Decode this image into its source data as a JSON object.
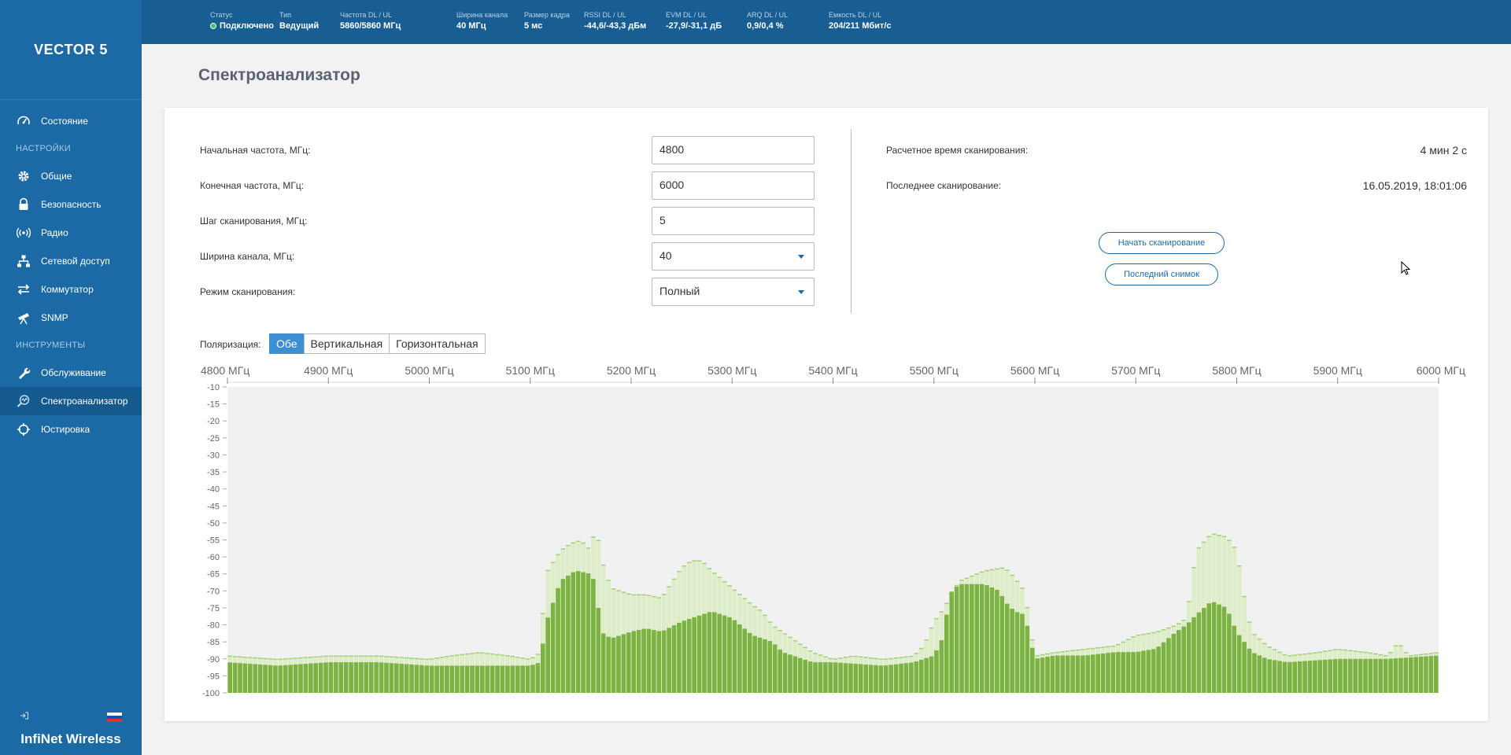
{
  "sidebar": {
    "brand": "VECTOR 5",
    "items": [
      {
        "label": "Состояние",
        "icon": "gauge-icon"
      },
      {
        "section": "НАСТРОЙКИ"
      },
      {
        "label": "Общие",
        "icon": "gear-icon"
      },
      {
        "label": "Безопасность",
        "icon": "lock-icon"
      },
      {
        "label": "Радио",
        "icon": "radio-waves-icon"
      },
      {
        "label": "Сетевой доступ",
        "icon": "network-icon"
      },
      {
        "label": "Коммутатор",
        "icon": "switch-arrows-icon"
      },
      {
        "label": "SNMP",
        "icon": "telescope-icon"
      },
      {
        "section": "ИНСТРУМЕНТЫ"
      },
      {
        "label": "Обслуживание",
        "icon": "wrench-icon"
      },
      {
        "label": "Спектроанализатор",
        "icon": "spectrum-search-icon",
        "active": true
      },
      {
        "label": "Юстировка",
        "icon": "crosshair-icon"
      }
    ],
    "company": "InfiNet Wireless"
  },
  "topbar": {
    "stats": [
      {
        "label": "Статус",
        "value": "Подключено"
      },
      {
        "label": "Тип",
        "value": "Ведущий"
      },
      {
        "label": "Частота DL / UL",
        "value": "5860/5860 МГц"
      },
      {
        "label": "Ширина канала",
        "value": "40 МГц"
      },
      {
        "label": "Размер кадра",
        "value": "5 мс"
      },
      {
        "label": "RSSI DL / UL",
        "value": "-44,6/-43,3 дБм"
      },
      {
        "label": "EVM DL / UL",
        "value": "-27,9/-31,1 дБ"
      },
      {
        "label": "ARQ DL / UL",
        "value": "0,9/0,4 %"
      },
      {
        "label": "Емкость DL / UL",
        "value": "204/211 Мбит/с"
      }
    ]
  },
  "page": {
    "title": "Спектроанализатор"
  },
  "form": {
    "start_label": "Начальная частота, МГц:",
    "start_value": "4800",
    "end_label": "Конечная частота, МГц:",
    "end_value": "6000",
    "step_label": "Шаг сканирования, МГц:",
    "step_value": "5",
    "width_label": "Ширина канала, МГц:",
    "width_value": "40",
    "mode_label": "Режим сканирования:",
    "mode_value": "Полный"
  },
  "info": {
    "est_label": "Расчетное время сканирования:",
    "est_value": "4 мин 2 с",
    "last_label": "Последнее сканирование:",
    "last_value": "16.05.2019, 18:01:06",
    "start_scan_button": "Начать сканирование",
    "last_snapshot_button": "Последний снимок"
  },
  "polarization": {
    "label": "Поляризация:",
    "options": [
      "Обе",
      "Вертикальная",
      "Горизонтальная"
    ],
    "selected": "Обе"
  },
  "colors": {
    "sidebar": "#1b6aa5",
    "topbar": "#185e93",
    "accent": "#3d8fd4",
    "bar_current": "#7cb342",
    "bar_peak": "#dcedc8"
  },
  "chart_data": {
    "type": "bar",
    "x_ticks": [
      "4800 МГц",
      "4900 МГц",
      "5000 МГц",
      "5100 МГц",
      "5200 МГц",
      "5300 МГц",
      "5400 МГц",
      "5500 МГц",
      "5600 МГц",
      "5700 МГц",
      "5800 МГц",
      "5900 МГц",
      "6000 МГц"
    ],
    "y_ticks": [
      -10,
      -15,
      -20,
      -25,
      -30,
      -35,
      -40,
      -45,
      -50,
      -55,
      -60,
      -65,
      -70,
      -75,
      -80,
      -85,
      -90,
      -95,
      -100
    ],
    "xlim": [
      4800,
      6000
    ],
    "ylim": [
      -100,
      -10
    ],
    "grid": false,
    "series": [
      {
        "x": [
          4800,
          4850,
          4900,
          4950,
          5000,
          5050,
          5100,
          5110,
          5115,
          5130,
          5145,
          5160,
          5165,
          5170,
          5180,
          5200,
          5215,
          5230,
          5250,
          5260,
          5280,
          5300,
          5320,
          5340,
          5350,
          5360,
          5380,
          5400,
          5450,
          5480,
          5490,
          5500,
          5510,
          5515,
          5525,
          5550,
          5565,
          5570,
          5580,
          5590,
          5600,
          5620,
          5650,
          5680,
          5700,
          5720,
          5740,
          5750,
          5760,
          5775,
          5790,
          5800,
          5810,
          5815,
          5830,
          5850,
          5900,
          5950,
          6000
        ],
        "values": [
          -91,
          -92,
          -91,
          -91,
          -92,
          -92,
          -92,
          -91,
          -80,
          -67,
          -64,
          -65,
          -68,
          -82,
          -84,
          -82,
          -81,
          -82,
          -79,
          -78,
          -76,
          -78,
          -83,
          -85,
          -88,
          -89,
          -91,
          -91,
          -92,
          -91,
          -90,
          -89,
          -83,
          -71,
          -68,
          -68,
          -70,
          -73,
          -76,
          -77,
          -90,
          -89,
          -89,
          -88,
          -88,
          -87,
          -82,
          -80,
          -77,
          -73,
          -75,
          -82,
          -86,
          -88,
          -90,
          -91,
          -90,
          -90,
          -89
        ]
      },
      {
        "x": [
          4800,
          4850,
          4900,
          4950,
          5000,
          5020,
          5050,
          5080,
          5100,
          5110,
          5115,
          5130,
          5140,
          5150,
          5160,
          5165,
          5170,
          5180,
          5200,
          5215,
          5230,
          5250,
          5260,
          5270,
          5280,
          5300,
          5320,
          5330,
          5340,
          5360,
          5380,
          5400,
          5420,
          5450,
          5480,
          5490,
          5500,
          5510,
          5515,
          5525,
          5550,
          5570,
          5580,
          5590,
          5600,
          5620,
          5650,
          5680,
          5700,
          5720,
          5740,
          5750,
          5760,
          5775,
          5790,
          5800,
          5810,
          5815,
          5830,
          5850,
          5880,
          5900,
          5930,
          5950,
          5960,
          5970,
          6000
        ],
        "values": [
          -89,
          -90,
          -89,
          -89,
          -90,
          -89,
          -88,
          -89,
          -90,
          -88,
          -65,
          -58,
          -56,
          -55,
          -58,
          -50,
          -60,
          -69,
          -71,
          -71,
          -72,
          -63,
          -61,
          -61,
          -64,
          -69,
          -74,
          -76,
          -80,
          -84,
          -88,
          -90,
          -89,
          -90,
          -89,
          -86,
          -79,
          -75,
          -72,
          -67,
          -64,
          -63,
          -66,
          -70,
          -89,
          -88,
          -87,
          -86,
          -83,
          -82,
          -80,
          -78,
          -58,
          -53,
          -54,
          -58,
          -76,
          -82,
          -86,
          -89,
          -88,
          -87,
          -88,
          -89,
          -85,
          -89,
          -88
        ]
      }
    ]
  }
}
